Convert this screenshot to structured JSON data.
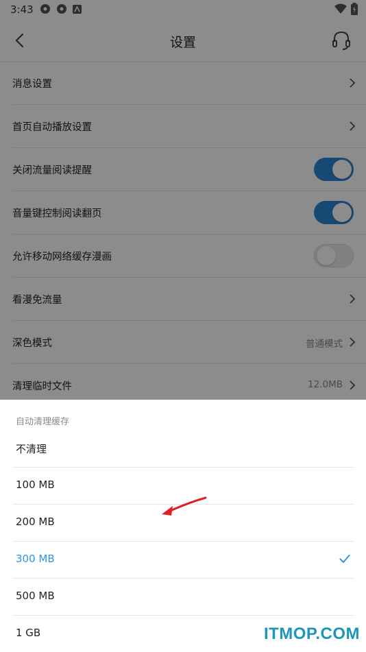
{
  "status_bar": {
    "time": "3:43"
  },
  "header": {
    "title": "设置"
  },
  "settings": {
    "rows": [
      {
        "label": "消息设置"
      },
      {
        "label": "首页自动播放设置"
      },
      {
        "label": "关闭流量阅读提醒",
        "toggle": "on"
      },
      {
        "label": "音量键控制阅读翻页",
        "toggle": "on"
      },
      {
        "label": "允许移动网络缓存漫画",
        "toggle": "off"
      },
      {
        "label": "看漫免流量"
      },
      {
        "label": "深色模式",
        "value": "普通模式"
      },
      {
        "label": "清理临时文件",
        "value": "12.0MB"
      }
    ]
  },
  "sheet": {
    "title": "自动清理缓存",
    "options": [
      {
        "label": "不清理"
      },
      {
        "label": "100 MB"
      },
      {
        "label": "200 MB"
      },
      {
        "label": "300 MB",
        "selected": true
      },
      {
        "label": "500 MB"
      },
      {
        "label": "1 GB"
      }
    ]
  },
  "watermark": "ITMOP.COM",
  "colors": {
    "accent": "#2f93e6",
    "toggle_on": "#2b86d6",
    "annotation_arrow": "#e02020",
    "watermark": "#1d96b8"
  }
}
